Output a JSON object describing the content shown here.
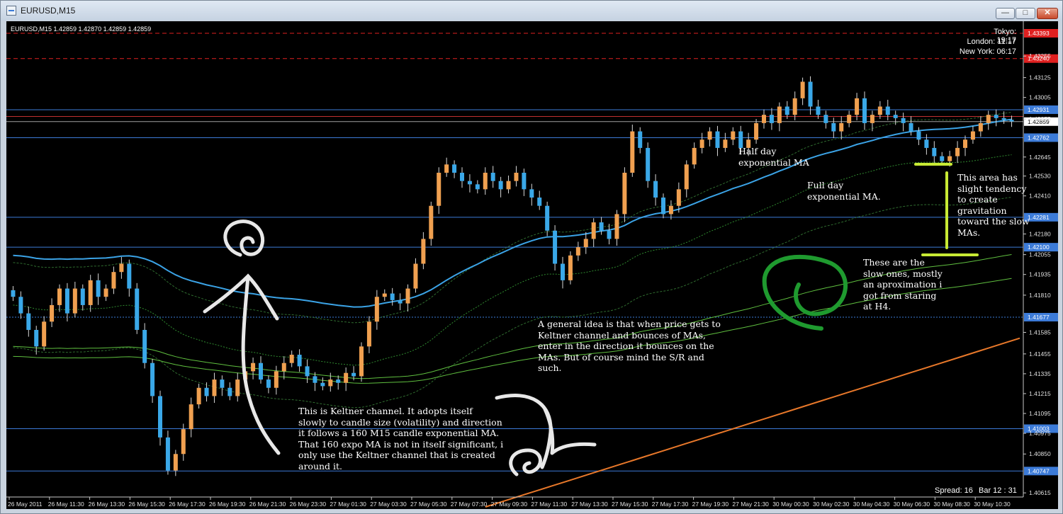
{
  "window": {
    "title": "EURUSD,M15",
    "min": "—",
    "max": "□",
    "close": "✕"
  },
  "chart_data": {
    "type": "candlestick",
    "symbol_header": "EURUSD,M15  1.42859 1.42870 1.42859 1.42859",
    "sessions": {
      "tokyo": "Tokyo: 19:17",
      "london": "London: 11:17",
      "newyork": "New York: 06:17"
    },
    "status": {
      "spread": "Spread: 16",
      "bar": "Bar  12 : 31"
    },
    "price_ticks": [
      "1.43255",
      "1.43125",
      "1.43005",
      "1.42875",
      "1.42645",
      "1.42530",
      "1.42410",
      "1.42180",
      "1.42055",
      "1.41935",
      "1.41810",
      "1.41585",
      "1.41455",
      "1.41335",
      "1.41215",
      "1.41095",
      "1.40975",
      "1.40850",
      "1.40615"
    ],
    "levels": [
      {
        "label": "1.43393",
        "value": 1.43393,
        "color": "#e02020",
        "style": "dash"
      },
      {
        "label": "1.43240",
        "value": 1.4324,
        "color": "#e02020",
        "style": "dash"
      },
      {
        "label": "1.42931",
        "value": 1.42931,
        "color": "#3c7bd8",
        "style": "solid"
      },
      {
        "label": "1.42859",
        "value": 1.42859,
        "color": "#ffffff",
        "style": "current"
      },
      {
        "label": "1.42762",
        "value": 1.42762,
        "color": "#3c7bd8",
        "style": "solid"
      },
      {
        "label": "1.42281",
        "value": 1.42281,
        "color": "#3c7bd8",
        "style": "solid"
      },
      {
        "label": "1.42100",
        "value": 1.421,
        "color": "#3c7bd8",
        "style": "solid"
      },
      {
        "label": "1.41677",
        "value": 1.41677,
        "color": "#3c7bd8",
        "style": "dot"
      },
      {
        "label": "1.41003",
        "value": 1.41003,
        "color": "#3c7bd8",
        "style": "solid"
      },
      {
        "label": "1.40747",
        "value": 1.40747,
        "color": "#3c7bd8",
        "style": "solid"
      }
    ],
    "time_labels": [
      "26 May 2011",
      "26 May 11:30",
      "26 May 13:30",
      "26 May 15:30",
      "26 May 17:30",
      "26 May 19:30",
      "26 May 21:30",
      "26 May 23:30",
      "27 May 01:30",
      "27 May 03:30",
      "27 May 05:30",
      "27 May 07:30",
      "27 May 09:30",
      "27 May 11:30",
      "27 May 13:30",
      "27 May 15:30",
      "27 May 17:30",
      "27 May 19:30",
      "27 May 21:30",
      "30 May 00:30",
      "30 May 02:30",
      "30 May 04:30",
      "30 May 06:30",
      "30 May 08:30",
      "30 May 10:30"
    ],
    "close_path": [
      1.418,
      1.417,
      1.416,
      1.415,
      1.4165,
      1.4175,
      1.4185,
      1.417,
      1.4185,
      1.4175,
      1.419,
      1.418,
      1.4185,
      1.4195,
      1.42,
      1.4185,
      1.416,
      1.414,
      1.412,
      1.4095,
      1.4075,
      1.4085,
      1.41,
      1.4115,
      1.4125,
      1.412,
      1.413,
      1.4125,
      1.412,
      1.413,
      1.4135,
      1.414,
      1.413,
      1.4125,
      1.4135,
      1.414,
      1.4145,
      1.4138,
      1.4132,
      1.4128,
      1.4126,
      1.413,
      1.4128,
      1.4134,
      1.4132,
      1.415,
      1.4165,
      1.418,
      1.4182,
      1.4178,
      1.4176,
      1.4185,
      1.42,
      1.4215,
      1.4235,
      1.4255,
      1.426,
      1.4255,
      1.425,
      1.4248,
      1.4245,
      1.4255,
      1.425,
      1.4245,
      1.425,
      1.4255,
      1.4245,
      1.424,
      1.4235,
      1.422,
      1.42,
      1.419,
      1.4205,
      1.421,
      1.4215,
      1.4225,
      1.422,
      1.4215,
      1.423,
      1.4255,
      1.428,
      1.427,
      1.425,
      1.424,
      1.423,
      1.4235,
      1.4245,
      1.426,
      1.427,
      1.4275,
      1.428,
      1.427,
      1.4275,
      1.428,
      1.427,
      1.4275,
      1.4285,
      1.429,
      1.4285,
      1.4295,
      1.429,
      1.43,
      1.431,
      1.4295,
      1.429,
      1.4285,
      1.428,
      1.4285,
      1.429,
      1.43,
      1.4285,
      1.429,
      1.4295,
      1.429,
      1.4288,
      1.4285,
      1.428,
      1.4275,
      1.427,
      1.4265,
      1.4262,
      1.4265,
      1.427,
      1.4275,
      1.428,
      1.4285,
      1.429,
      1.4288,
      1.4287,
      1.4286
    ],
    "series": [
      {
        "name": "Keltner upper",
        "color": "#2f6c2f"
      },
      {
        "name": "Keltner mid (160 EMA)",
        "color": "#2f8a2f"
      },
      {
        "name": "Keltner lower",
        "color": "#2f6c2f"
      },
      {
        "name": "Half day EMA",
        "color": "#3ba3e6"
      },
      {
        "name": "Full day EMA",
        "color": "#5fbf3f"
      },
      {
        "name": "Slow MA",
        "color": "#e8782a"
      }
    ]
  },
  "annotations": {
    "half_day": "Half day\nexponential MA",
    "full_day": "Full day\nexponential MA.",
    "gravitation": "This area has\nslight tendency\nto create\ngravitation\ntoward the slow\nMAs.",
    "slow_ones": "These are the\nslow ones, mostly\nan aproximation i\ngot from staring\nat H4.",
    "general_idea": "A general idea is that when price gets to\nKeltner channel and bounces of MAs,\nenter in the direction it bounces on the\nMAs. But of course mind the S/R and\nsuch.",
    "keltner": "This is Keltner channel. It adopts itself\nslowly to candle size (volatility) and direction\nit follows a 160 M15 candle exponential MA.\nThat 160 expo MA is not in itself significant, i\nonly use the Keltner channel that is created\naround it."
  }
}
